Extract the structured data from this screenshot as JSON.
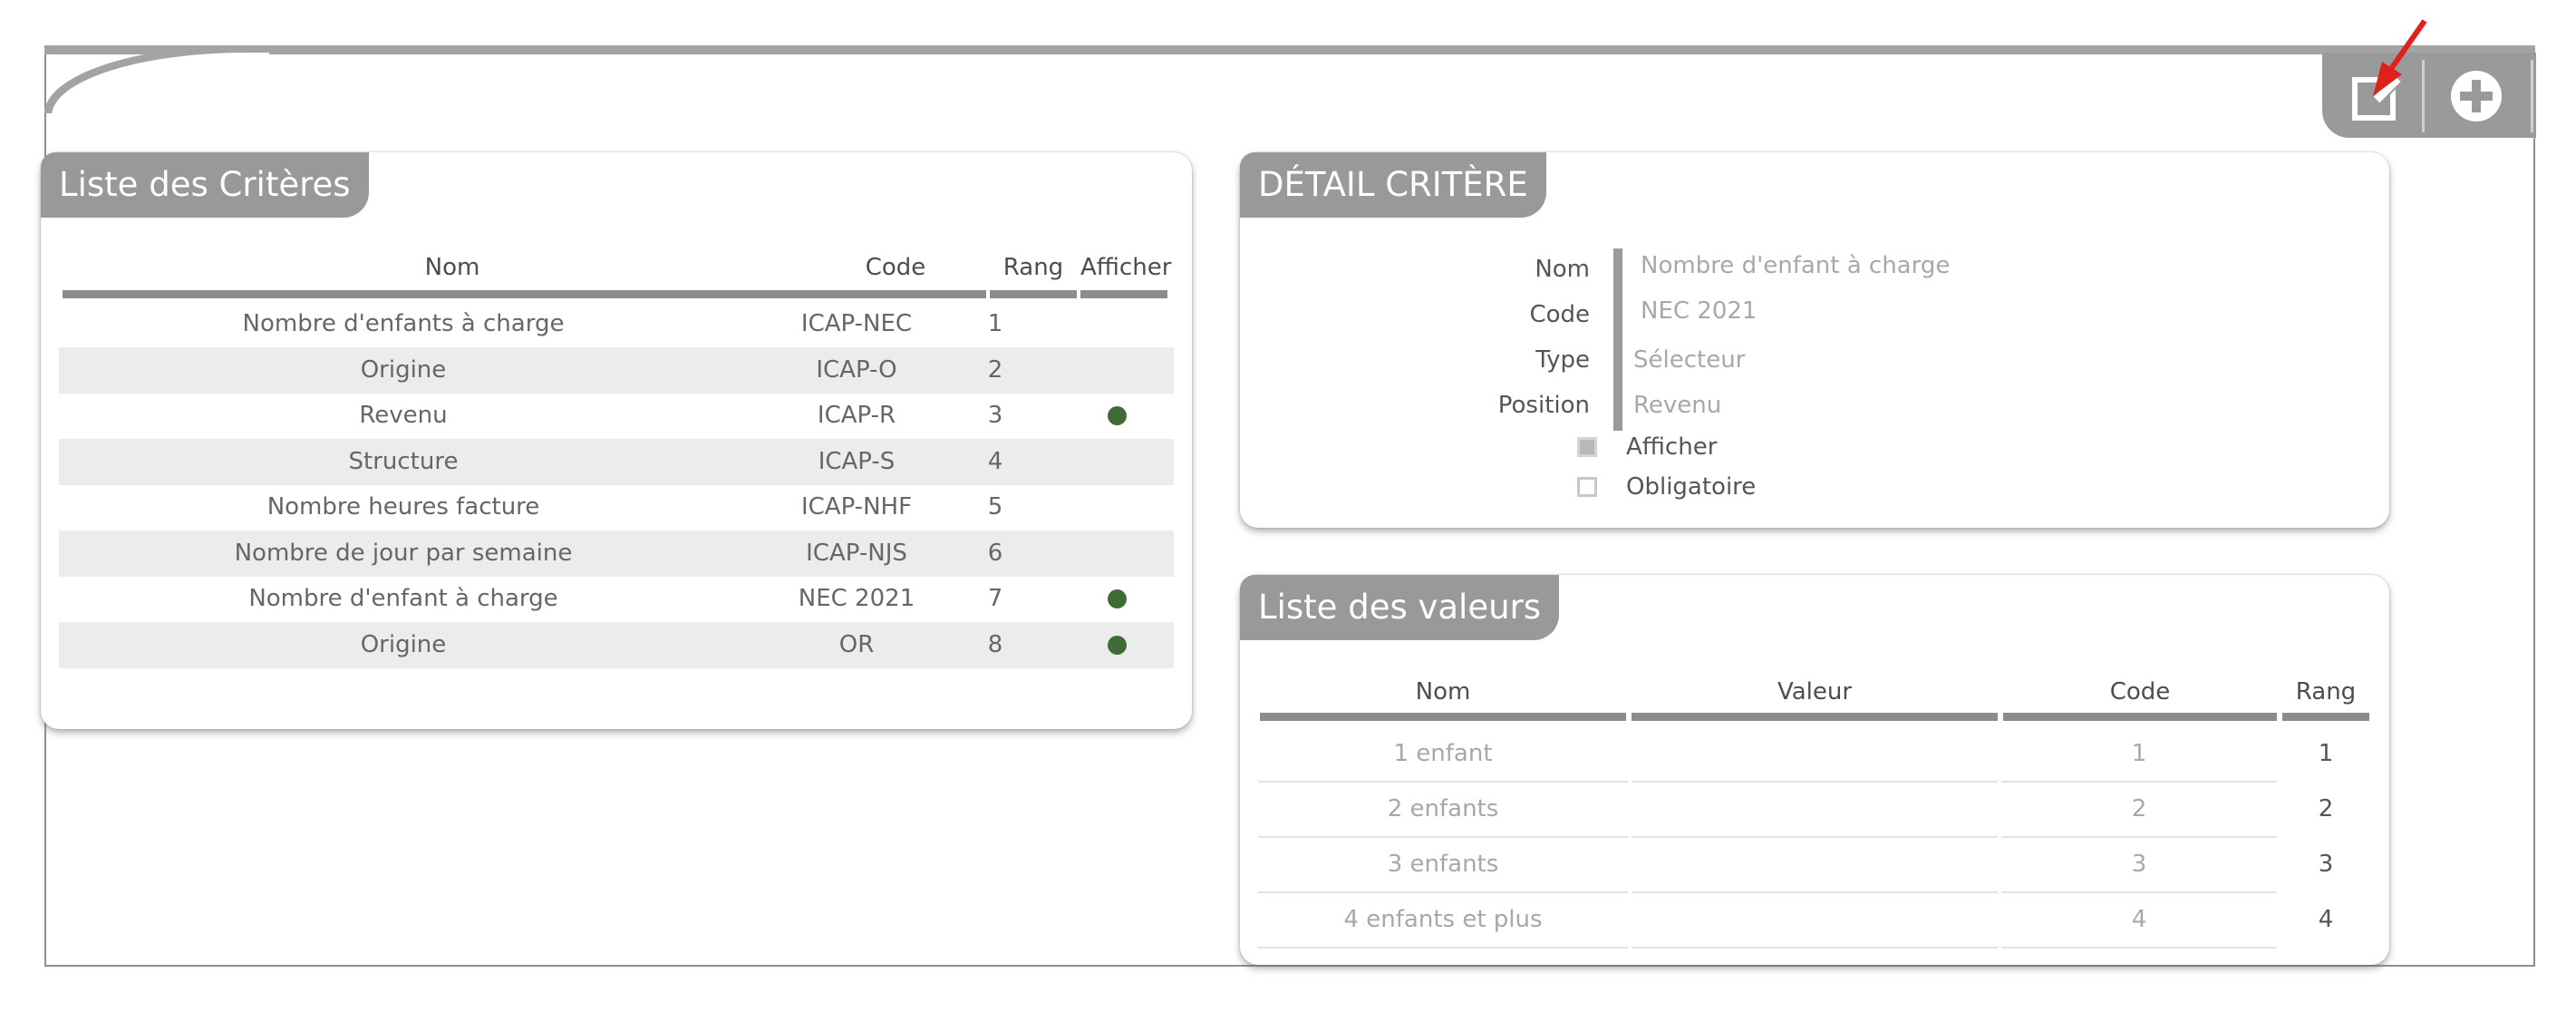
{
  "toolbar": {
    "edit_icon": "edit-icon",
    "add_icon": "plus-circle-icon"
  },
  "criteria_list": {
    "title": "Liste des Critères",
    "headers": {
      "name": "Nom",
      "code": "Code",
      "rank": "Rang",
      "show": "Afficher"
    },
    "rows": [
      {
        "name": "Nombre d'enfants à charge",
        "code": "ICAP-NEC",
        "rank": "1",
        "show": false
      },
      {
        "name": "Origine",
        "code": "ICAP-O",
        "rank": "2",
        "show": false
      },
      {
        "name": "Revenu",
        "code": "ICAP-R",
        "rank": "3",
        "show": true
      },
      {
        "name": "Structure",
        "code": "ICAP-S",
        "rank": "4",
        "show": false
      },
      {
        "name": "Nombre heures facture",
        "code": "ICAP-NHF",
        "rank": "5",
        "show": false
      },
      {
        "name": "Nombre de jour par semaine",
        "code": "ICAP-NJS",
        "rank": "6",
        "show": false
      },
      {
        "name": "Nombre d'enfant à charge",
        "code": "NEC 2021",
        "rank": "7",
        "show": true
      },
      {
        "name": "Origine",
        "code": "OR",
        "rank": "8",
        "show": true
      }
    ],
    "show_dot_color": "#3e6b36"
  },
  "criteria_detail": {
    "title": "DÉTAIL CRITÈRE",
    "fields": {
      "name": {
        "label": "Nom",
        "value": "Nombre d'enfant à charge"
      },
      "code": {
        "label": "Code",
        "value": "NEC 2021"
      },
      "type": {
        "label": "Type",
        "value": "Sélecteur"
      },
      "position": {
        "label": "Position",
        "value": "Revenu"
      }
    },
    "show_checkbox": {
      "label": "Afficher",
      "checked": true
    },
    "required_checkbox": {
      "label": "Obligatoire",
      "checked": false
    }
  },
  "values_list": {
    "title": "Liste des valeurs",
    "headers": {
      "name": "Nom",
      "value": "Valeur",
      "code": "Code",
      "rank": "Rang"
    },
    "rows": [
      {
        "name": "1 enfant",
        "value": "",
        "code": "1",
        "rank": "1"
      },
      {
        "name": "2 enfants",
        "value": "",
        "code": "2",
        "rank": "2"
      },
      {
        "name": "3 enfants",
        "value": "",
        "code": "3",
        "rank": "3"
      },
      {
        "name": "4 enfants et plus",
        "value": "",
        "code": "4",
        "rank": "4"
      }
    ]
  },
  "colors": {
    "panel_header": "#999999",
    "accent_arrow": "#e0201b"
  }
}
